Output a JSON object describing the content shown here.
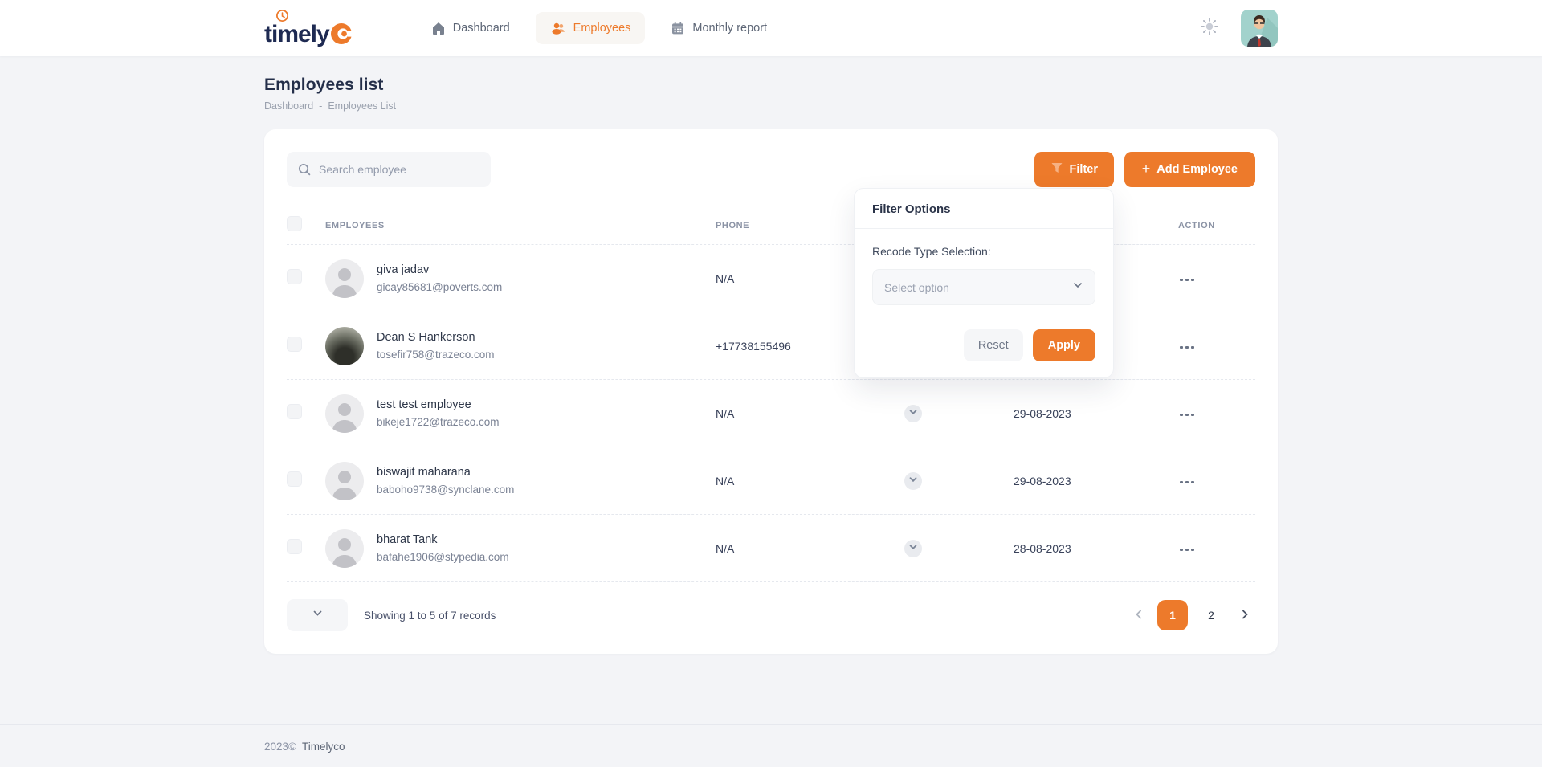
{
  "colors": {
    "accent": "#ED7A2B",
    "navy": "#1E2A52",
    "page_bg": "#F3F4F7"
  },
  "brand": {
    "name": "timely",
    "mark": "co-circle"
  },
  "nav": {
    "items": [
      {
        "label": "Dashboard",
        "icon": "home-icon",
        "active": false
      },
      {
        "label": "Employees",
        "icon": "users-icon",
        "active": true
      },
      {
        "label": "Monthly report",
        "icon": "calendar-icon",
        "active": false
      }
    ]
  },
  "page": {
    "title": "Employees list",
    "breadcrumb": {
      "part1": "Dashboard",
      "separator": "-",
      "part2": "Employees List"
    }
  },
  "toolbar": {
    "search_placeholder": "Search employee",
    "filter_label": "Filter",
    "add_plus": "+",
    "add_label": "Add Employee"
  },
  "table": {
    "headers": {
      "employees": "EMPLOYEES",
      "phone": "PHONE",
      "action": "ACTION"
    },
    "rows": [
      {
        "name": "giva jadav",
        "email": "gicay85681@poverts.com",
        "phone": "N/A",
        "date": "",
        "status_icon": false,
        "avatar": "placeholder"
      },
      {
        "name": "Dean S Hankerson",
        "email": "tosefir758@trazeco.com",
        "phone": "+17738155496",
        "date": "",
        "status_icon": false,
        "avatar": "photo"
      },
      {
        "name": "test test employee",
        "email": "bikeje1722@trazeco.com",
        "phone": "N/A",
        "date": "29-08-2023",
        "status_icon": true,
        "avatar": "placeholder"
      },
      {
        "name": "biswajit maharana",
        "email": "baboho9738@synclane.com",
        "phone": "N/A",
        "date": "29-08-2023",
        "status_icon": true,
        "avatar": "placeholder"
      },
      {
        "name": "bharat Tank",
        "email": "bafahe1906@stypedia.com",
        "phone": "N/A",
        "date": "28-08-2023",
        "status_icon": true,
        "avatar": "placeholder"
      }
    ]
  },
  "filter_popup": {
    "title": "Filter Options",
    "field_label": "Recode Type Selection:",
    "select_placeholder": "Select option",
    "reset_label": "Reset",
    "apply_label": "Apply"
  },
  "pagination": {
    "summary": "Showing 1 to 5 of 7 records",
    "pages": [
      "1",
      "2"
    ],
    "active_page": "1"
  },
  "footer": {
    "year": "2023©",
    "brand": "Timelyco"
  }
}
